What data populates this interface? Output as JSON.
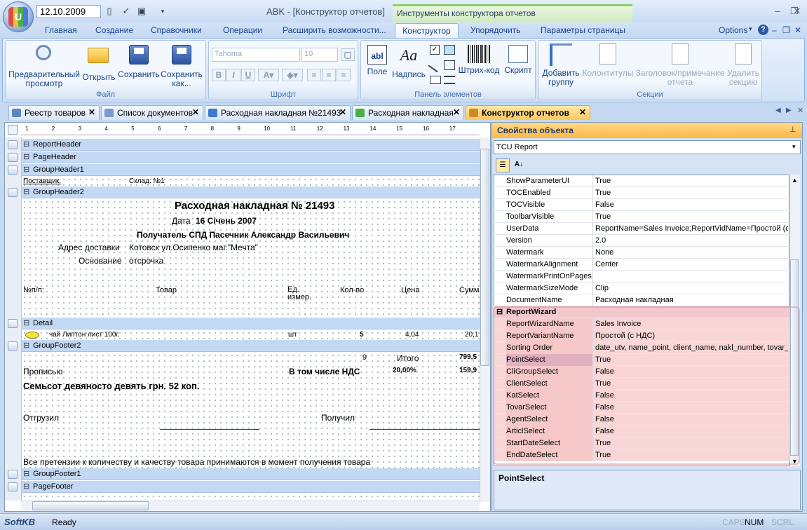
{
  "titlebar": {
    "date": "12.10.2009",
    "title": "ABK - [Конструктор отчетов]",
    "context_title": "Инструменты конструктора отчетов",
    "logo_text": "U"
  },
  "ribbon_tabs": [
    "Главная",
    "Создание",
    "Справочники",
    "Операции",
    "Расширить возможности...",
    "Конструктор",
    "Упорядочить",
    "Параметры страницы"
  ],
  "options_label": "Options",
  "groups": {
    "file": {
      "label": "Файл",
      "buttons": [
        "Предварительный просмотр",
        "Открыть",
        "Сохранить",
        "Сохранить как..."
      ]
    },
    "font": {
      "label": "Шрифт",
      "font_name": "Tahoma",
      "font_size": "10"
    },
    "elements": {
      "label": "Панель элементов",
      "buttons": [
        "Поле",
        "Надпись",
        "Штрих-код",
        "Скрипт"
      ]
    },
    "sections": {
      "label": "Секции",
      "buttons": [
        "Добавить группу",
        "Колонтитулы",
        "Заголовок/примечание отчета",
        "Удалить секцию"
      ]
    }
  },
  "doc_tabs": [
    "Реестр товаров",
    "Список документов",
    "Расходная накладная №21493",
    "Расходная накладная",
    "Конструктор отчетов"
  ],
  "bands": [
    "ReportHeader",
    "PageHeader",
    "GroupHeader1",
    "GroupHeader2",
    "Detail",
    "GroupFooter2",
    "GroupFooter1",
    "PageFooter"
  ],
  "report": {
    "supplier": "Поставщик:",
    "warehouse": "Склад: №1",
    "title": "Расходная накладная № 21493",
    "date_label": "Дата",
    "date_value": "16 Січень 2007",
    "recipient": "Получатель  СПД Пасечник Александр Васильевич",
    "address_label": "Адрес доставки",
    "address_value": "Котовск ул.Осипенко маг.\"Мечта\"",
    "basis_label": "Основание",
    "basis_value": "отсрочка",
    "cols": [
      "№п/п:",
      "Товар",
      "Ед. измер.",
      "Кол-во",
      "Цена",
      "Сумм"
    ],
    "detail_product": "чай Липтон лист 100г.",
    "detail_unit": "шт",
    "detail_qty": "5",
    "detail_price": "4,04",
    "detail_sum": "20,1",
    "count": "9",
    "total_label": "Итого",
    "total_value": "799,5",
    "words_label": "Прописью",
    "vat_label": "В том числе НДС",
    "vat_pct": "20,00%",
    "vat_value": "159,9",
    "words_value": "Семьсот девяносто девять  грн. 52 коп.",
    "shipped": "Отгрузил",
    "received": "Получил",
    "claims": "Все претензии к количеству и качеству товара принимаются в момент получения товара"
  },
  "ruler_numbers": [
    "1",
    "2",
    "3",
    "4",
    "5",
    "6",
    "7",
    "8",
    "9",
    "10",
    "11",
    "12",
    "13",
    "14",
    "15",
    "16",
    "17"
  ],
  "props": {
    "header": "Свойства объекта",
    "object": "TCU Report",
    "rows": [
      {
        "n": "ShowParameterUI",
        "v": "True"
      },
      {
        "n": "TOCEnabled",
        "v": "True"
      },
      {
        "n": "TOCVisible",
        "v": "False"
      },
      {
        "n": "ToolbarVisible",
        "v": "True"
      },
      {
        "n": "UserData",
        "v": "ReportName=Sales Invoice;ReportVidName=Простой (с Н"
      },
      {
        "n": "Version",
        "v": "2.0"
      },
      {
        "n": "Watermark",
        "v": "None"
      },
      {
        "n": "WatermarkAlignment",
        "v": "Center"
      },
      {
        "n": "WatermarkPrintOnPages",
        "v": ""
      },
      {
        "n": "WatermarkSizeMode",
        "v": "Clip"
      },
      {
        "n": "DocumentName",
        "v": "Расходная накладная"
      }
    ],
    "category": "ReportWizard",
    "wizard_rows": [
      {
        "n": "ReportWizardName",
        "v": "Sales Invoice"
      },
      {
        "n": "ReportVariantName",
        "v": "Простой (с НДС)"
      },
      {
        "n": "Sorting Order",
        "v": "date_utv, name_point, client_name, nakl_number, tovar_n"
      },
      {
        "n": "PointSelect",
        "v": "True"
      },
      {
        "n": "CliGroupSelect",
        "v": "False"
      },
      {
        "n": "ClientSelect",
        "v": "True"
      },
      {
        "n": "KatSelect",
        "v": "False"
      },
      {
        "n": "TovarSelect",
        "v": "False"
      },
      {
        "n": "AgentSelect",
        "v": "False"
      },
      {
        "n": "ArticlSelect",
        "v": "False"
      },
      {
        "n": "StartDateSelect",
        "v": "True"
      },
      {
        "n": "EndDateSelect",
        "v": "True"
      }
    ],
    "selected_desc": "PointSelect"
  },
  "status": {
    "logo": "SoftKB",
    "ready": "Ready",
    "caps": "CAPS",
    "num": "NUM",
    "scrl": "SCRL"
  }
}
